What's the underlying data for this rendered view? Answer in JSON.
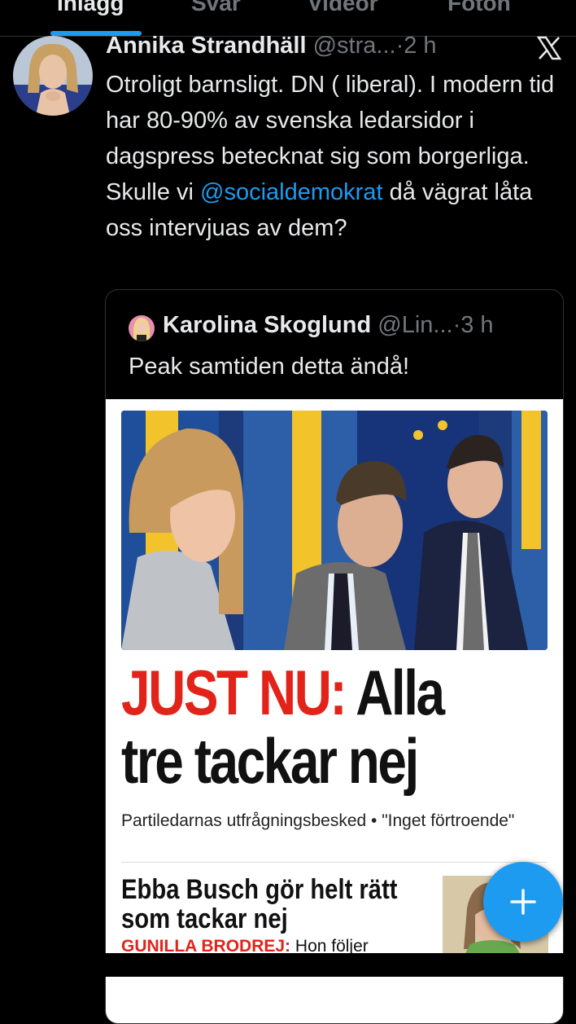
{
  "tabs": [
    {
      "label": "Inlägg",
      "active": true
    },
    {
      "label": "Svar",
      "active": false
    },
    {
      "label": "Videor",
      "active": false
    },
    {
      "label": "Foton",
      "active": false
    }
  ],
  "tweet": {
    "author_name": "Annika Strandhäll",
    "author_handle": "@stra...",
    "time": "·2 h",
    "text_before": "Otroligt barnsligt. DN ( liberal). I modern tid har 80-90% av svenska ledarsidor i dagspress betecknat sig som borgerliga.",
    "text_line2_pre": "Skulle vi ",
    "mention": "@socialdemokrat",
    "text_line2_post": " då vägrat låta oss intervjuas av dem?"
  },
  "quote": {
    "author_name": "Karolina Skoglund",
    "author_handle": "@Lin...",
    "time": "·3 h",
    "text": "Peak samtiden detta ändå!",
    "article": {
      "headline_red": "JUST NU:",
      "headline_black_1": " Alla",
      "headline_black_2": "tre tackar nej",
      "subline": "Partiledarnas utfrågningsbesked • \"Inget förtroende\"",
      "sub_headline_1": "Ebba Busch gör helt rätt",
      "sub_headline_2": "som tackar nej",
      "byline_name": "GUNILLA BRODREJ:",
      "byline_text": " Hon följer"
    }
  },
  "colors": {
    "accent": "#1d9bf0",
    "background": "#000000",
    "muted": "#71767b",
    "headline_red": "#e2231a"
  },
  "icons": {
    "x_logo": "x-logo-icon",
    "compose": "plus-icon"
  }
}
